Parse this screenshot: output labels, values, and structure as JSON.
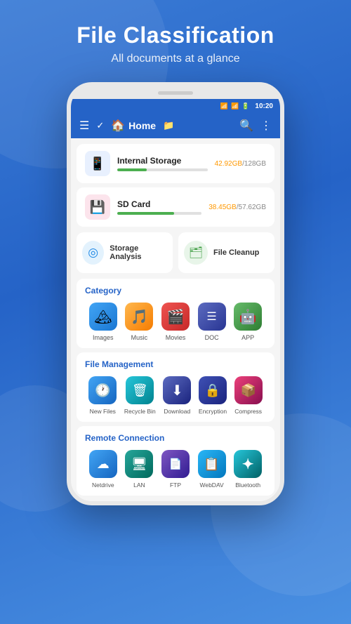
{
  "background": {
    "color_start": "#3a7bd5",
    "color_end": "#2563c7"
  },
  "header": {
    "title": "File Classification",
    "subtitle": "All documents at a glance"
  },
  "status_bar": {
    "time": "10:20"
  },
  "toolbar": {
    "title": "Home",
    "home_icon": "🏠"
  },
  "storage": [
    {
      "name": "Internal Storage",
      "used": "42.92GB",
      "total": "128GB",
      "percent": 33,
      "bar_color": "#4caf50",
      "icon": "📱",
      "icon_class": "storage-icon-blue"
    },
    {
      "name": "SD Card",
      "used": "38.45GB",
      "total": "57.62GB",
      "percent": 67,
      "bar_color": "#4caf50",
      "icon": "💾",
      "icon_class": "storage-icon-pink"
    }
  ],
  "tools": [
    {
      "label": "Storage Analysis",
      "icon": "◎",
      "icon_class": "tool-icon-blue"
    },
    {
      "label": "File Cleanup",
      "icon": "🗂",
      "icon_class": "tool-icon-green"
    }
  ],
  "category": {
    "title": "Category",
    "items": [
      {
        "label": "Images",
        "icon": "🏔",
        "color_class": "cat-blue"
      },
      {
        "label": "Music",
        "icon": "🎵",
        "color_class": "cat-orange"
      },
      {
        "label": "Movies",
        "icon": "🎬",
        "color_class": "cat-red"
      },
      {
        "label": "DOC",
        "icon": "☰",
        "color_class": "cat-darkblue"
      },
      {
        "label": "APP",
        "icon": "🤖",
        "color_class": "cat-green2"
      }
    ]
  },
  "file_management": {
    "title": "File Management",
    "items": [
      {
        "label": "New Files",
        "icon": "🕐",
        "color_class": "fm-blue"
      },
      {
        "label": "Recycle Bin",
        "icon": "🗑",
        "color_class": "fm-teal"
      },
      {
        "label": "Download",
        "icon": "⬇",
        "color_class": "fm-dblue"
      },
      {
        "label": "Encryption",
        "icon": "🔒",
        "color_class": "fm-navy"
      },
      {
        "label": "Compress",
        "icon": "📦",
        "color_class": "fm-pink"
      }
    ]
  },
  "remote_connection": {
    "title": "Remote Connection",
    "items": [
      {
        "label": "Netdrive",
        "icon": "☁",
        "color_class": "rm-blue"
      },
      {
        "label": "LAN",
        "icon": "🖥",
        "color_class": "rm-green"
      },
      {
        "label": "FTP",
        "icon": "📄",
        "color_class": "rm-purple"
      },
      {
        "label": "WebDAV",
        "icon": "📋",
        "color_class": "rm-lblue"
      },
      {
        "label": "Bluetooth",
        "icon": "✦",
        "color_class": "rm-cyan"
      }
    ]
  }
}
